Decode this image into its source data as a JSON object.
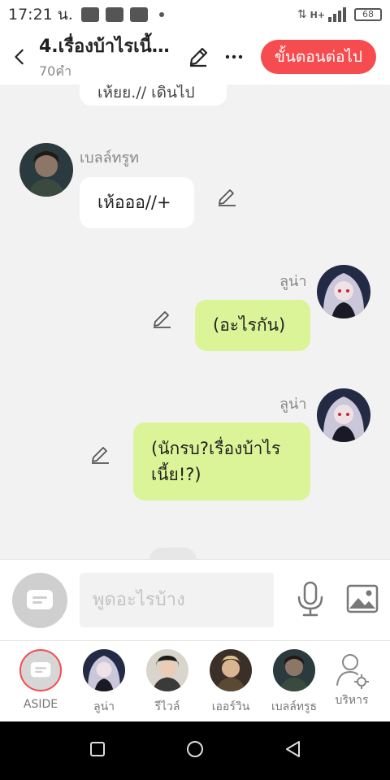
{
  "status": {
    "time": "17:21 น.",
    "network": "H+",
    "battery": "68"
  },
  "header": {
    "title": "4.เรื่องบ้าไรเนี้ย...",
    "word_count": "70คำ",
    "next_label": "ขั้นตอนต่อไป"
  },
  "messages": {
    "cut_text": "เห้ยย.// เดินไป",
    "m1": {
      "name": "เบลล์ทรูท",
      "text": "เห้อออ//+"
    },
    "m2": {
      "name": "ลูน่า",
      "text": "(อะไรกัน)"
    },
    "m3": {
      "name": "ลูน่า",
      "text_line1": "(นักรบ?เรื่องบ้าไร",
      "text_line2": "เนี้ย!?)"
    }
  },
  "input": {
    "placeholder": "พูดอะไรบ้าง"
  },
  "characters": [
    {
      "label": "ASIDE"
    },
    {
      "label": "ลูน่า"
    },
    {
      "label": "รีไวล์"
    },
    {
      "label": "เออร์วิน"
    },
    {
      "label": "เบลล์ทรูธ"
    },
    {
      "label": "บริหาร"
    }
  ],
  "colors": {
    "accent": "#f64b4f",
    "bubble_right": "#dbf497",
    "bubble_left": "#ffffff",
    "chat_bg": "#f2f2f2"
  }
}
